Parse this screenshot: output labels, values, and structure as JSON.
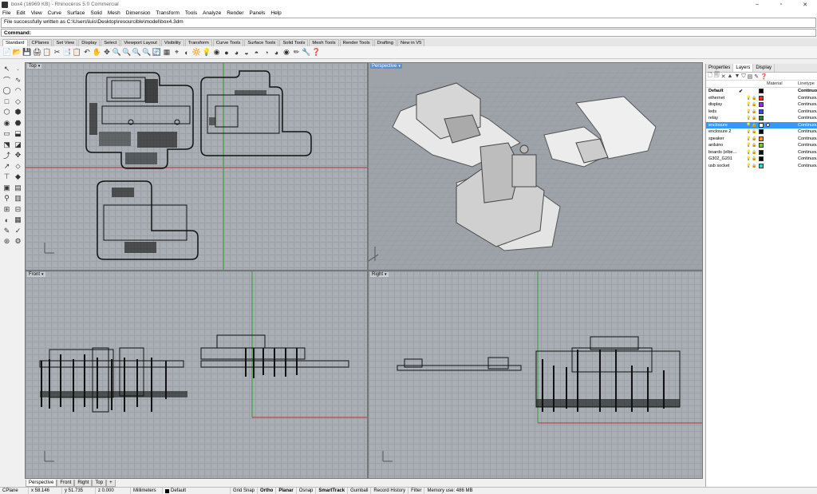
{
  "window": {
    "title": "box4 (16969 KB) - Rhinoceros 5.0 Commercial",
    "minimize": "–",
    "maximize": "▫",
    "close": "✕"
  },
  "menu": [
    "File",
    "Edit",
    "View",
    "Curve",
    "Surface",
    "Solid",
    "Mesh",
    "Dimension",
    "Transform",
    "Tools",
    "Analyze",
    "Render",
    "Panels",
    "Help"
  ],
  "command": {
    "history": "File successfully written as C:\\Users\\luis\\Desktop\\resourcible\\model\\box4.3dm",
    "prompt": "Command:",
    "value": ""
  },
  "toolbar_tabs": [
    "Standard",
    "CPlanes",
    "Set View",
    "Display",
    "Select",
    "Viewport Layout",
    "Visibility",
    "Transform",
    "Curve Tools",
    "Surface Tools",
    "Solid Tools",
    "Mesh Tools",
    "Render Tools",
    "Drafting",
    "New in V5"
  ],
  "toolbar_icons": [
    "📄",
    "📂",
    "💾",
    "🖨",
    "📋",
    "✂",
    "📑",
    "📋",
    "↶",
    "✋",
    "✥",
    "🔍",
    "🔍",
    "🔍",
    "🔍",
    "🔄",
    "▦",
    "⌖",
    "◐",
    "🔆",
    "💡",
    "◉",
    "●",
    "◕",
    "◒",
    "◓",
    "◔",
    "◕",
    "◉",
    "✏",
    "🔧",
    "❓"
  ],
  "left_tools": [
    "↖",
    "·",
    "⌒",
    "∿",
    "◯",
    "◠",
    "□",
    "◇",
    "⬡",
    "⬢",
    "◉",
    "⬣",
    "▭",
    "⬓",
    "⬔",
    "◪",
    "⤴",
    "✥",
    "↗",
    "⬦",
    "⊤",
    "◆",
    "▣",
    "▤",
    "⚲",
    "▥",
    "⊞",
    "⊟",
    "◐",
    "▦",
    "✎",
    "✓",
    "⊛",
    "⚙"
  ],
  "viewports": {
    "top": {
      "label": "Top"
    },
    "perspective": {
      "label": "Perspective"
    },
    "front": {
      "label": "Front"
    },
    "right": {
      "label": "Right"
    }
  },
  "view_tabs": [
    "Perspective",
    "Front",
    "Right",
    "Top",
    "+"
  ],
  "status": {
    "cplane": "CPlane",
    "x": "x 58.146",
    "y": "y 51.735",
    "z": "z 0.000",
    "units": "Millimeters",
    "layer": "Default",
    "grid_snap": "Grid Snap",
    "ortho": "Ortho",
    "planar": "Planar",
    "osnap": "Osnap",
    "smarttrack": "SmartTrack",
    "gumball": "Gumball",
    "record_history": "Record History",
    "filter": "Filter",
    "memory": "Memory use: 486 MB"
  },
  "panel": {
    "tabs": [
      "Properties",
      "Layers",
      "Display"
    ],
    "col_material": "Material",
    "col_linetype": "Linetype",
    "layers": [
      {
        "name": "Default",
        "current": "✔",
        "color": "#000000",
        "linetype": "Continuo",
        "bold": true
      },
      {
        "name": "ethernet",
        "current": "",
        "color": "#ff2a2a",
        "linetype": "Continuou"
      },
      {
        "name": "display",
        "current": "",
        "color": "#a020f0",
        "linetype": "Continuou"
      },
      {
        "name": "leds",
        "current": "",
        "color": "#2a4aff",
        "linetype": "Continuou"
      },
      {
        "name": "relay",
        "current": "",
        "color": "#208040",
        "linetype": "Continuou"
      },
      {
        "name": "enclosure",
        "current": "",
        "color": "#ffffff",
        "linetype": "Continuou",
        "selected": true
      },
      {
        "name": "enclosure 2",
        "current": "",
        "color": "#000000",
        "linetype": "Continuou"
      },
      {
        "name": "speaker",
        "current": "",
        "color": "#ff8a20",
        "linetype": "Continuou"
      },
      {
        "name": "arduino",
        "current": "",
        "color": "#70d020",
        "linetype": "Continuou"
      },
      {
        "name": "boards (elbe...",
        "current": "",
        "color": "#111111",
        "linetype": "Continuou"
      },
      {
        "name": "G302_G201",
        "current": "",
        "color": "#000000",
        "linetype": "Continuou"
      },
      {
        "name": "usb socket",
        "current": "",
        "color": "#30d0d0",
        "linetype": "Continuou"
      }
    ]
  }
}
